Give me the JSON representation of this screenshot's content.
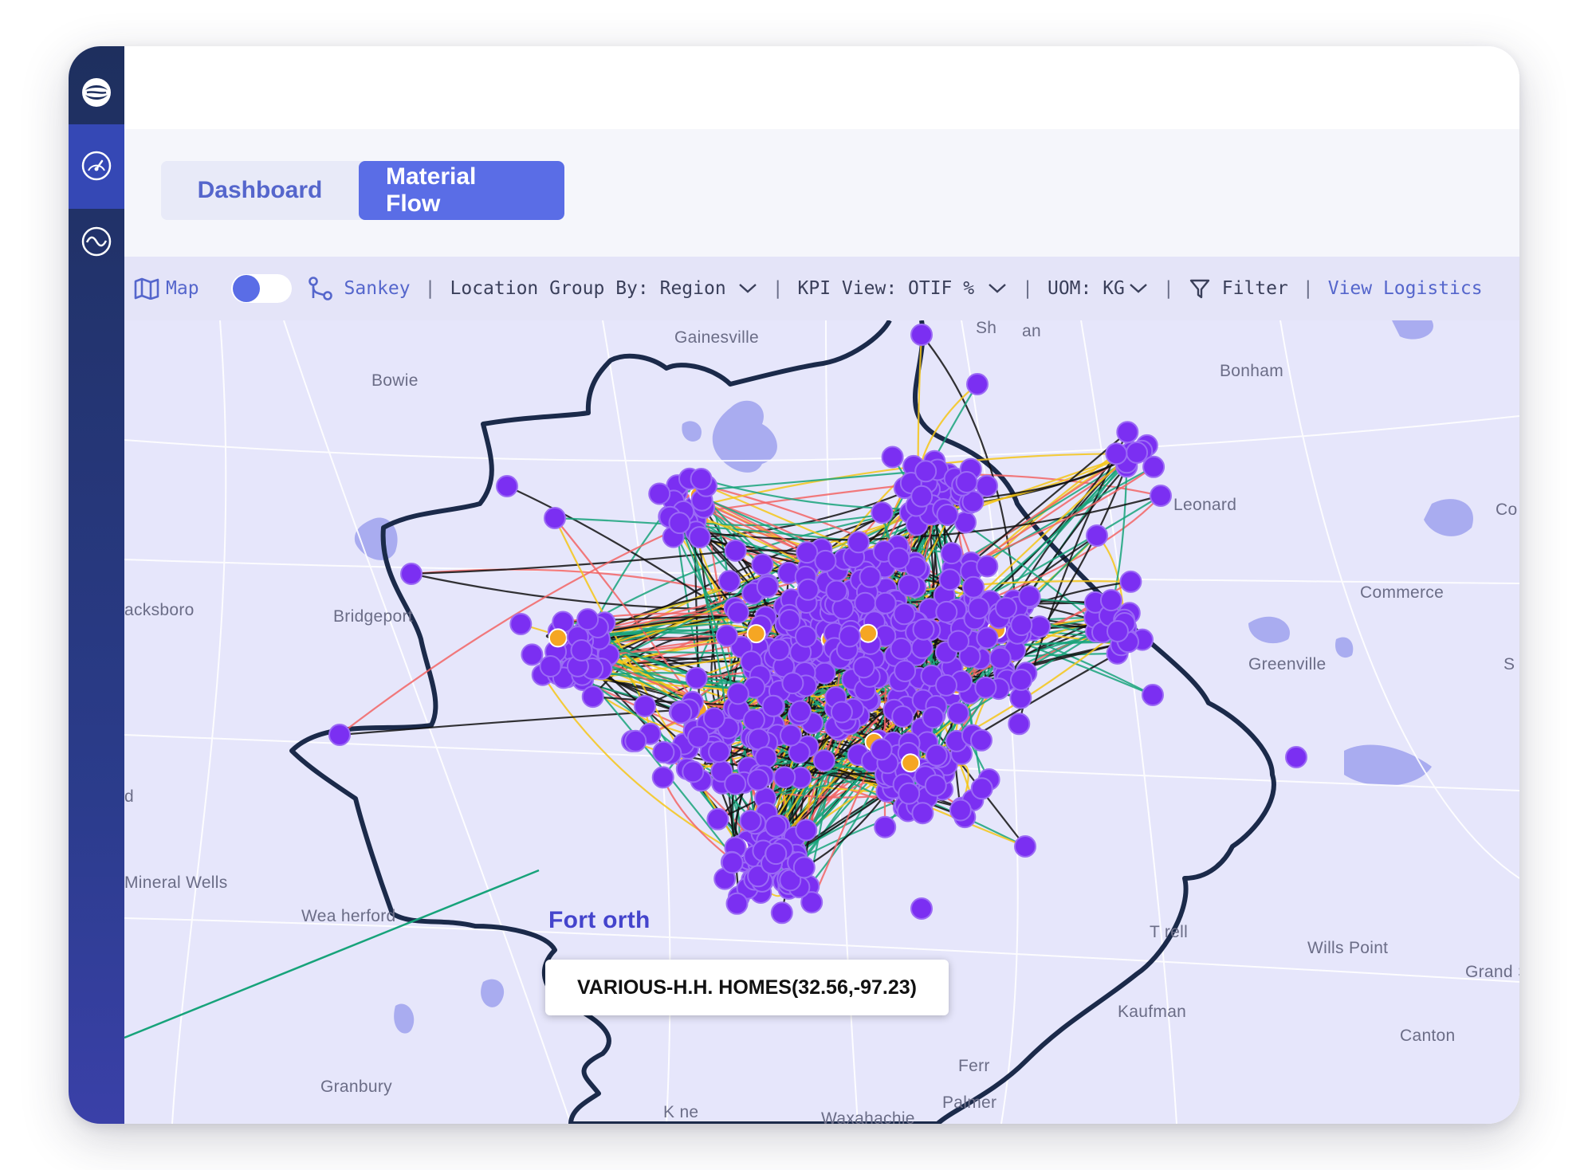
{
  "tabs": [
    {
      "label": "Dashboard",
      "active": false
    },
    {
      "label": "Material Flow",
      "active": true
    }
  ],
  "toolbar": {
    "map_label": "Map",
    "view_toggle_on": false,
    "sankey_label": "Sankey",
    "location_group": "Location Group By: Region",
    "kpi_view": "KPI View: OTIF %",
    "uom": "UOM: KG",
    "filter_label": "Filter",
    "view_logistics": "View Logistics",
    "separator": "|"
  },
  "map": {
    "places": {
      "gainesville": "Gainesville",
      "bowie": "Bowie",
      "sherman": "Sh",
      "sherman2": "an",
      "bonham": "Bonham",
      "leonard": "Leonard",
      "commerce": "Commerce",
      "greenville": "Greenville",
      "jacksboro": "acksboro",
      "bridgeport": "Bridgeport",
      "mineral_wells": "Mineral Wells",
      "weatherford": "Wea herford",
      "fort_worth": "Fort  orth",
      "granbury": "Granbury",
      "kaufman": "Kaufman",
      "terrell": "T  rell",
      "wills_point": "Wills Point",
      "canton": "Canton",
      "grand": "Grand S",
      "palmer": "Palmer",
      "waxahachie": "Waxahachie",
      "ferris": "Ferr",
      "keene": "K  ne",
      "co": "Co",
      "s": "S",
      "d": "d"
    },
    "tooltip": "VARIOUS-H.H. HOMES(32.56,-97.23)",
    "colors": {
      "background": "#e6e6fb",
      "water": "#a9acf0",
      "road": "#ffffff",
      "boundary": "#1b2a4a",
      "node": "#7b2ff2",
      "node_stroke": "#9b6af5",
      "hub": "#f5a623",
      "flow_black": "#111111",
      "flow_green": "#17a37a",
      "flow_red": "#f26464",
      "flow_yellow": "#f5c518"
    }
  }
}
